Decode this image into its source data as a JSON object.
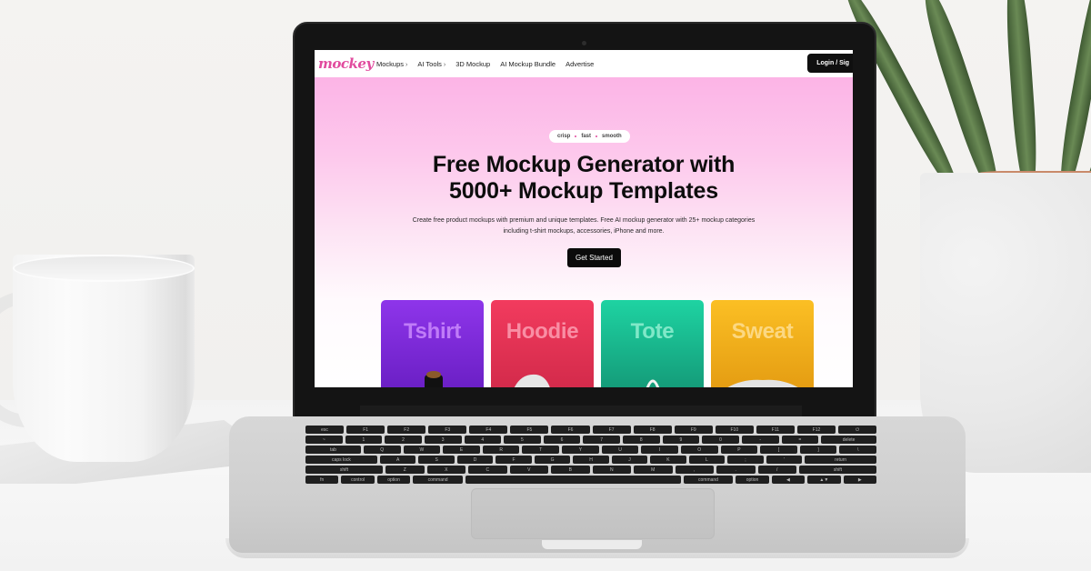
{
  "website": {
    "logo": "mockey",
    "nav": [
      {
        "label": "Mockups",
        "has_chevron": true
      },
      {
        "label": "AI Tools",
        "has_chevron": true
      },
      {
        "label": "3D Mockup",
        "has_chevron": false
      },
      {
        "label": "AI Mockup Bundle",
        "has_chevron": false
      },
      {
        "label": "Advertise",
        "has_chevron": false
      }
    ],
    "chevron_glyph": "›",
    "login_label": "Login / Sig",
    "hero": {
      "tags": [
        "crisp",
        "fast",
        "smooth"
      ],
      "title_line1": "Free Mockup Generator with",
      "title_line2": "5000+ Mockup Templates",
      "subtitle_line1": "Create free product mockups with premium and unique templates. Free AI mockup generator with 25+ mockup categories",
      "subtitle_line2": "including t-shirt mockups, accessories, iPhone and more.",
      "cta_label": "Get Started"
    },
    "categories": [
      {
        "label": "Tshirt",
        "bg_top": "#8e35ea",
        "bg_bottom": "#6a1fc4",
        "text_color": "#c07cf8",
        "product": "tshirt-product-icon"
      },
      {
        "label": "Hoodie",
        "bg_top": "#f23b5e",
        "bg_bottom": "#d22a4a",
        "text_color": "#f98ea4",
        "product": "hoodie-product-icon"
      },
      {
        "label": "Tote",
        "bg_top": "#1ed3a2",
        "bg_bottom": "#149a78",
        "text_color": "#80e8c8",
        "product": "tote-bag-product-icon"
      },
      {
        "label": "Sweat",
        "bg_top": "#fbbf24",
        "bg_bottom": "#e49c12",
        "text_color": "#fcd882",
        "product": "sweatshirt-product-icon"
      }
    ]
  },
  "keyboard": {
    "rows": [
      [
        "esc",
        "F1",
        "F2",
        "F3",
        "F4",
        "F5",
        "F6",
        "F7",
        "F8",
        "F9",
        "F10",
        "F11",
        "F12",
        "⏻"
      ],
      [
        "~",
        "1",
        "2",
        "3",
        "4",
        "5",
        "6",
        "7",
        "8",
        "9",
        "0",
        "-",
        "=",
        "delete"
      ],
      [
        "tab",
        "Q",
        "W",
        "E",
        "R",
        "T",
        "Y",
        "U",
        "I",
        "O",
        "P",
        "[",
        "]",
        "\\"
      ],
      [
        "caps lock",
        "A",
        "S",
        "D",
        "F",
        "G",
        "H",
        "J",
        "K",
        "L",
        ";",
        "'",
        "return"
      ],
      [
        "shift",
        "Z",
        "X",
        "C",
        "V",
        "B",
        "N",
        "M",
        ",",
        ".",
        "/",
        "shift"
      ],
      [
        "fn",
        "control",
        "option",
        "command",
        "",
        "command",
        "option",
        "◀",
        "▲▼",
        "▶"
      ]
    ]
  }
}
